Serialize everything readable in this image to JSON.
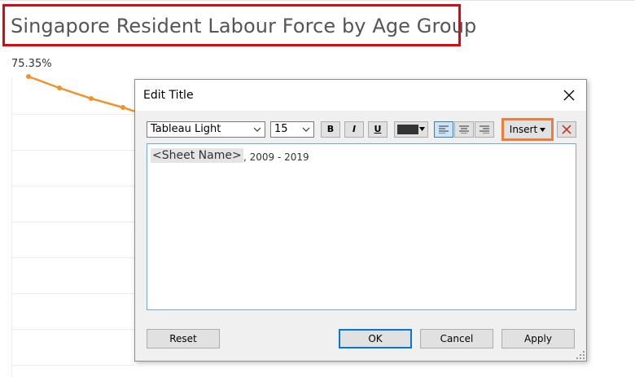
{
  "sheet": {
    "title": "Singapore Resident Labour Force by Age Group",
    "first_value_label": "75.35%",
    "line_color": "#f0932b"
  },
  "dialog": {
    "title": "Edit Title",
    "font_family": "Tableau Light",
    "font_size": "15",
    "bold_label": "B",
    "italic_label": "I",
    "underline_label": "U",
    "text_color": "#333333",
    "insert_label": "Insert",
    "editor": {
      "token": "<Sheet Name>",
      "suffix": ", 2009 - 2019"
    },
    "buttons": {
      "reset": "Reset",
      "ok": "OK",
      "cancel": "Cancel",
      "apply": "Apply"
    },
    "icons": [
      "close-icon",
      "chevron-down-icon",
      "align-left-icon",
      "align-center-icon",
      "align-right-icon",
      "clear-format-icon",
      "resize-grip-icon"
    ],
    "highlight_color": "#f07c3c",
    "annotation_color": "#e8000b"
  }
}
